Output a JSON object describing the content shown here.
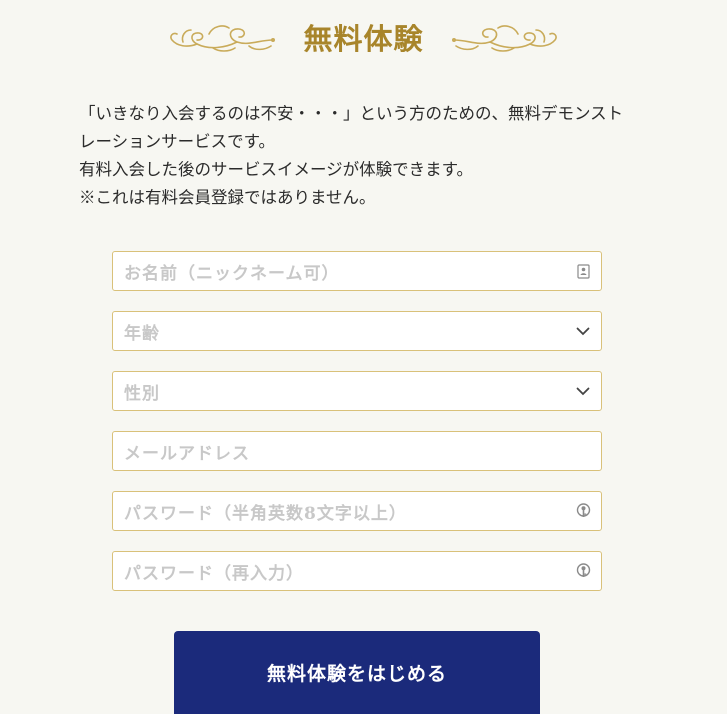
{
  "header": {
    "title": "無料体験"
  },
  "intro": {
    "lines": [
      "「いきなり入会するのは不安・・・」という方のための、無料デモンストレーションサービスです。",
      "有料入会した後のサービスイメージが体験できます。",
      "※これは有料会員登録ではありません。"
    ]
  },
  "form": {
    "nickname": {
      "placeholder": "お名前（ニックネーム可）",
      "icon": "id-card-icon"
    },
    "age": {
      "placeholder": "年齢",
      "icon": "chevron-down-icon"
    },
    "gender": {
      "placeholder": "性別",
      "icon": "chevron-down-icon"
    },
    "email": {
      "placeholder": "メールアドレス"
    },
    "password": {
      "placeholder": "パスワード（半角英数8文字以上）",
      "icon": "key-icon"
    },
    "password_confirm": {
      "placeholder": "パスワード（再入力）",
      "icon": "key-icon"
    }
  },
  "submit": {
    "label": "無料体験をはじめる"
  },
  "colors": {
    "gold": "#a8852b",
    "border": "#d9c17a",
    "button": "#1b2a7b",
    "background": "#f7f7f2"
  }
}
